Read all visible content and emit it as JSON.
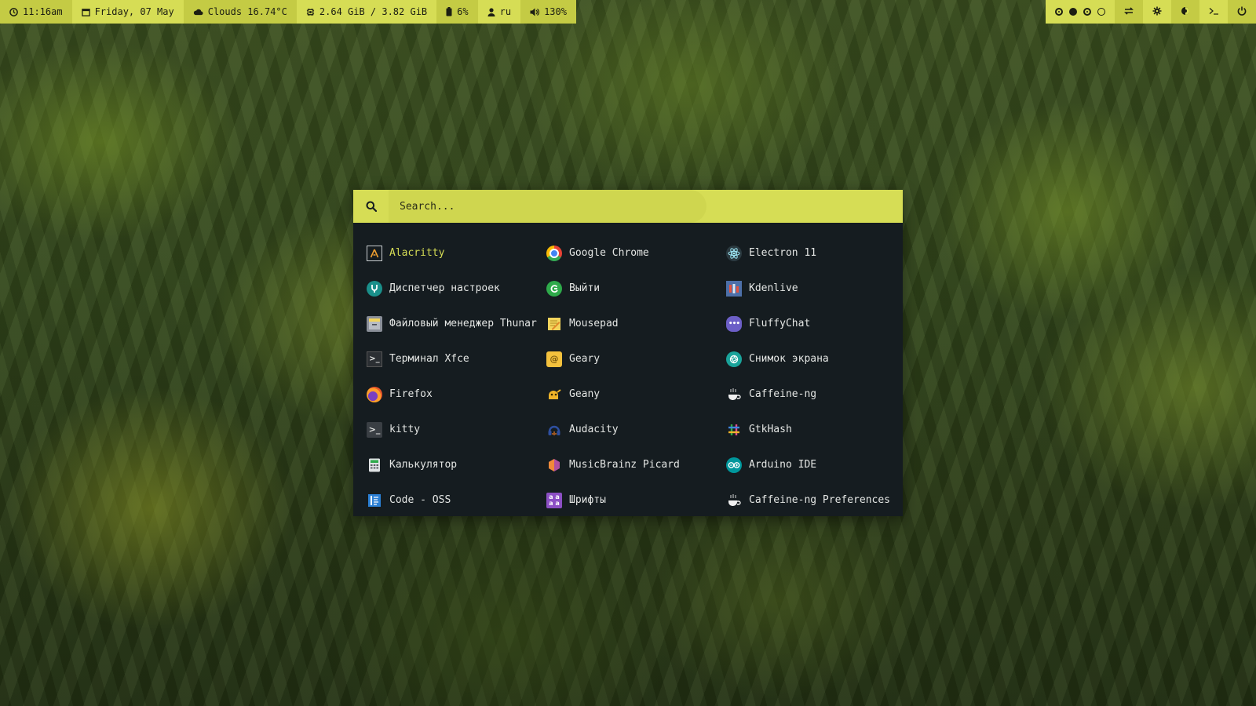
{
  "topbar": {
    "time": "11:16am",
    "date": "Friday, 07 May",
    "weather": "Clouds 16.74°C",
    "memory": "2.64 GiB / 3.82 GiB",
    "battery": "6%",
    "keyboard_layout": "ru",
    "volume": "130%",
    "right_icons": [
      "workspace-icons",
      "swap-icon",
      "gear-icon",
      "sun-moon-icon",
      "terminal-prompt-icon",
      "power-icon"
    ]
  },
  "launcher": {
    "search_placeholder": "Search...",
    "columns": [
      [
        {
          "label": "Alacritty",
          "icon": "alacritty-icon",
          "color": "#c8cdd0",
          "selected": true
        },
        {
          "label": "Диспетчер настроек",
          "icon": "settings-manager-icon",
          "color": "#1a8f8a"
        },
        {
          "label": "Файловый менеджер Thunar",
          "icon": "thunar-icon",
          "color": "#8a8f98"
        },
        {
          "label": "Терминал Xfce",
          "icon": "xfce-terminal-icon",
          "color": "#2b2f33"
        },
        {
          "label": "Firefox",
          "icon": "firefox-icon",
          "color": "#e8572a"
        },
        {
          "label": "kitty",
          "icon": "kitty-icon",
          "color": "#3a3f44"
        },
        {
          "label": "Калькулятор",
          "icon": "calculator-icon",
          "color": "#dfe2e4"
        },
        {
          "label": "Code - OSS",
          "icon": "code-oss-icon",
          "color": "#2b7fd4"
        }
      ],
      [
        {
          "label": "Google Chrome",
          "icon": "chrome-icon",
          "color": "#e94235"
        },
        {
          "label": "Выйти",
          "icon": "logout-icon",
          "color": "#2eaa4a"
        },
        {
          "label": "Mousepad",
          "icon": "mousepad-icon",
          "color": "#f2d45c"
        },
        {
          "label": "Geary",
          "icon": "geary-icon",
          "color": "#f4c13d"
        },
        {
          "label": "Geany",
          "icon": "geany-icon",
          "color": "#f0b429"
        },
        {
          "label": "Audacity",
          "icon": "audacity-icon",
          "color": "#2e4fa0"
        },
        {
          "label": "MusicBrainz Picard",
          "icon": "picard-icon",
          "color": "#b04fa0"
        },
        {
          "label": "Шрифты",
          "icon": "fonts-icon",
          "color": "#8c4fc4"
        }
      ],
      [
        {
          "label": "Electron 11",
          "icon": "electron-icon",
          "color": "#47848f"
        },
        {
          "label": "Kdenlive",
          "icon": "kdenlive-icon",
          "color": "#4d6fa8"
        },
        {
          "label": "FluffyChat",
          "icon": "fluffychat-icon",
          "color": "#6c5fc7"
        },
        {
          "label": "Снимок экрана",
          "icon": "screenshot-icon",
          "color": "#1aa39a"
        },
        {
          "label": "Caffeine-ng",
          "icon": "caffeine-icon",
          "color": "#f0f0f0"
        },
        {
          "label": "GtkHash",
          "icon": "gtkhash-icon",
          "color": "#e04f8a"
        },
        {
          "label": "Arduino IDE",
          "icon": "arduino-icon",
          "color": "#00979c"
        },
        {
          "label": "Caffeine-ng Preferences",
          "icon": "caffeine-preferences-icon",
          "color": "#f0f0f0"
        }
      ]
    ]
  }
}
